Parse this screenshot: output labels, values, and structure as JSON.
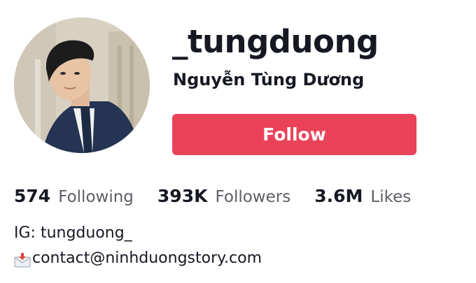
{
  "profile": {
    "username": "_tungduong",
    "nickname": "Nguyễn Tùng Dương",
    "avatar": "profile-photo"
  },
  "actions": {
    "follow_label": "Follow",
    "follow_color": "#ea4359"
  },
  "stats": [
    {
      "value": "574",
      "label": "Following"
    },
    {
      "value": "393K",
      "label": "Followers"
    },
    {
      "value": "3.6M",
      "label": "Likes"
    }
  ],
  "bio": {
    "line1": "IG: tungduong_",
    "line2_icon": "incoming-envelope-icon",
    "line2": "contact@ninhduongstory.com"
  }
}
